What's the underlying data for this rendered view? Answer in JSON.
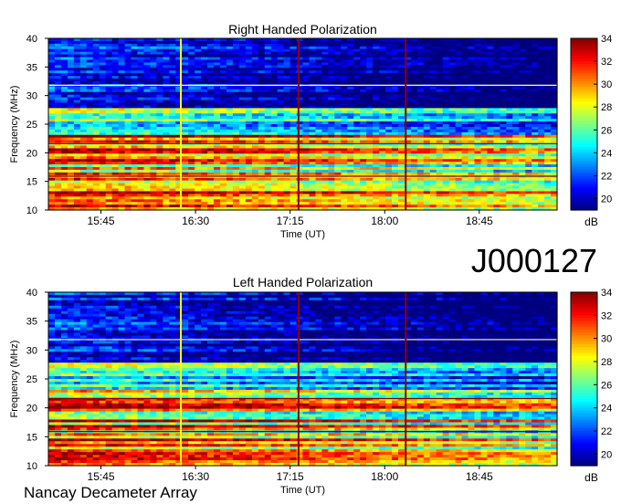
{
  "observation_id": "J000127",
  "instrument": "Nancay Decameter Array",
  "chart_data": [
    {
      "type": "heatmap",
      "title": "Right Handed Polarization",
      "xlabel": "Time (UT)",
      "ylabel": "Frequency (MHz)",
      "x_ticks": [
        "15:45",
        "16:30",
        "17:15",
        "18:00",
        "18:45"
      ],
      "x_range": [
        "15:20",
        "19:22"
      ],
      "y_ticks": [
        10,
        15,
        20,
        25,
        30,
        35,
        40
      ],
      "ylim": [
        10,
        40
      ],
      "colorbar_label": "dB",
      "colorbar_ticks": [
        20,
        22,
        24,
        26,
        28,
        30,
        32,
        34
      ],
      "colorbar_range": [
        19,
        34
      ],
      "colormap": [
        "#00007f",
        "#0000ff",
        "#007fff",
        "#00ffff",
        "#7fff7f",
        "#ffff00",
        "#ff7f00",
        "#ff0000",
        "#7f0000"
      ],
      "vertical_lines": [
        {
          "time": "16:23",
          "color": "#ffff00"
        },
        {
          "time": "17:19",
          "color": "#8b0000"
        },
        {
          "time": "18:10",
          "color": "#8b0000"
        }
      ],
      "horizontal_lines": [
        {
          "freq": 31.8,
          "color": "#ffffaa"
        },
        {
          "freq": 21.6,
          "color": "#8b0000"
        },
        {
          "freq": 15.9,
          "color": "#8b0000"
        }
      ]
    },
    {
      "type": "heatmap",
      "title": "Left Handed Polarization",
      "xlabel": "Time (UT)",
      "ylabel": "Frequency (MHz)",
      "x_ticks": [
        "15:45",
        "16:30",
        "17:15",
        "18:00",
        "18:45"
      ],
      "x_range": [
        "15:20",
        "19:22"
      ],
      "y_ticks": [
        10,
        15,
        20,
        25,
        30,
        35,
        40
      ],
      "ylim": [
        10,
        40
      ],
      "colorbar_label": "dB",
      "colorbar_ticks": [
        20,
        22,
        24,
        26,
        28,
        30,
        32,
        34
      ],
      "colorbar_range": [
        19,
        34
      ],
      "colormap": [
        "#00007f",
        "#0000ff",
        "#007fff",
        "#00ffff",
        "#7fff7f",
        "#ffff00",
        "#ff7f00",
        "#ff0000",
        "#7f0000"
      ],
      "vertical_lines": [
        {
          "time": "16:23",
          "color": "#ffff00"
        },
        {
          "time": "17:19",
          "color": "#8b0000"
        },
        {
          "time": "18:10",
          "color": "#8b0000"
        }
      ],
      "horizontal_lines": [
        {
          "freq": 31.8,
          "color": "#ffffaa"
        },
        {
          "freq": 21.6,
          "color": "#8b0000"
        },
        {
          "freq": 15.9,
          "color": "#8b0000"
        }
      ]
    }
  ]
}
